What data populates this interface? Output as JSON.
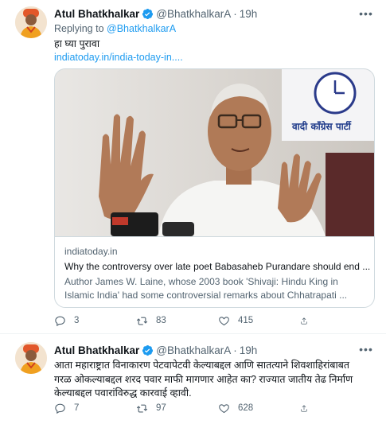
{
  "tweets": [
    {
      "author": {
        "name": "Atul Bhatkhalkar",
        "handle": "@BhatkhalkarA",
        "time": "19h",
        "verified": true
      },
      "reply_prefix": "Replying to ",
      "reply_to": "@BhatkhalkarA",
      "text": "हा घ्या पुरावा",
      "link": "indiatoday.in/india-today-in....",
      "card": {
        "domain": "indiatoday.in",
        "title": "Why the controversy over late poet Babasaheb Purandare should end ...",
        "description_line1": "Author James W. Laine, whose 2003 book 'Shivaji: Hindu King in",
        "description_line2": "Islamic India' had some controversial remarks about Chhatrapati ...",
        "image_banner": "वादी कॉंग्रेस पार्टी"
      },
      "stats": {
        "replies": "3",
        "retweets": "83",
        "likes": "415"
      }
    },
    {
      "author": {
        "name": "Atul Bhatkhalkar",
        "handle": "@BhatkhalkarA",
        "time": "19h",
        "verified": true
      },
      "text_line1": "आता महाराष्ट्रात विनाकारण पेटवापेटवी केल्याबद्दल आणि सातत्याने शिवशाहिरांबाबत",
      "text_line2": "गरळ ओकल्याबद्दल शरद पवार माफी मागणार आहेत का?  राज्यात जातीय तेढ निर्माण",
      "text_line3": "केल्याबद्दल पवारांविरुद्ध कारवाई व्हावी.",
      "stats": {
        "replies": "7",
        "retweets": "97",
        "likes": "628"
      }
    }
  ],
  "colors": {
    "accent": "#1d9bf0",
    "secondary_text": "#536471",
    "border": "#cfd9de"
  },
  "icons": [
    "more-icon",
    "verified-icon",
    "reply-icon",
    "retweet-icon",
    "like-icon",
    "share-icon"
  ]
}
